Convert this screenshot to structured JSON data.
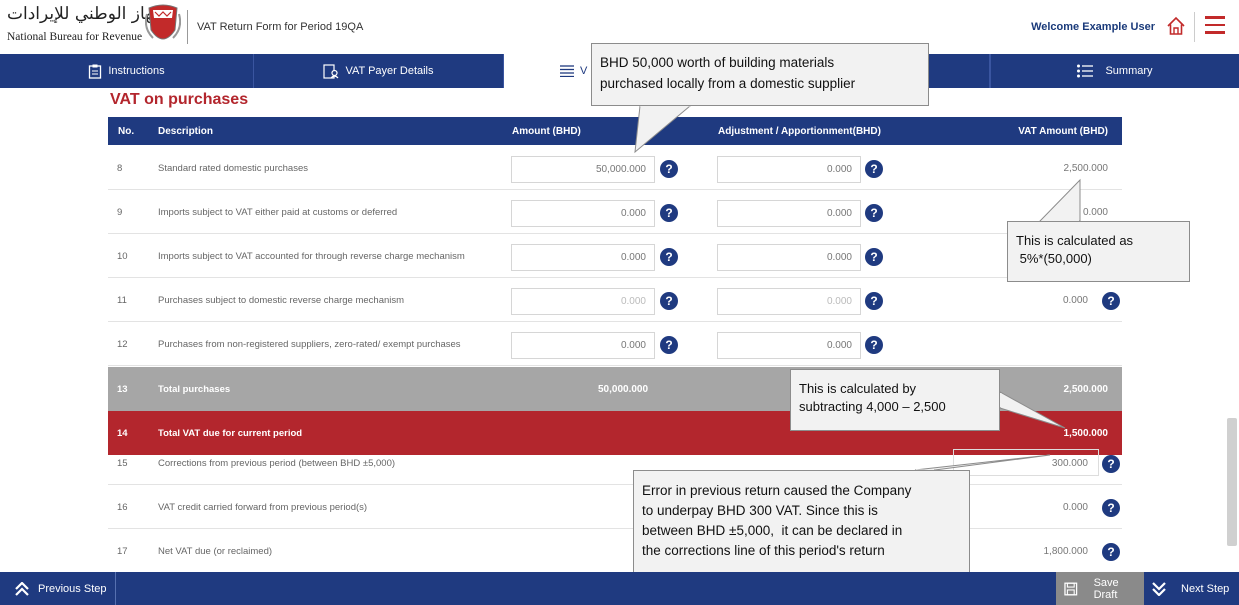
{
  "header": {
    "logo_arabic": "الجهاز الوطني للإيرادات",
    "logo_english": "National Bureau for Revenue",
    "form_title": "VAT Return Form for Period 19QA",
    "welcome": "Welcome Example User"
  },
  "tabs": [
    {
      "label": "Instructions",
      "icon": "clipboard-icon"
    },
    {
      "label": "VAT Payer Details",
      "icon": "user-doc-icon"
    },
    {
      "label": "V",
      "icon": "list-icon"
    },
    {
      "label": "",
      "icon": ""
    },
    {
      "label": "Summary",
      "icon": "summary-list-icon"
    }
  ],
  "section_title": "VAT on purchases",
  "table": {
    "headers": {
      "no": "No.",
      "description": "Description",
      "amount": "Amount (BHD)",
      "adjustment": "Adjustment / Apportionment(BHD)",
      "vat": "VAT Amount (BHD)"
    },
    "rows": [
      {
        "no": "8",
        "description": "Standard rated domestic purchases",
        "amount": "50,000.000",
        "adjustment": "0.000",
        "vat": "2,500.000"
      },
      {
        "no": "9",
        "description": "Imports subject to VAT either paid at customs or deferred",
        "amount": "0.000",
        "adjustment": "0.000",
        "vat": "0.000"
      },
      {
        "no": "10",
        "description": "Imports subject to VAT accounted for through reverse charge mechanism",
        "amount": "0.000",
        "adjustment": "0.000",
        "vat": ""
      },
      {
        "no": "11",
        "description": "Purchases subject to domestic reverse charge mechanism",
        "amount": "0.000",
        "adjustment": "0.000",
        "vat": "0.000"
      },
      {
        "no": "12",
        "description": "Purchases from non-registered suppliers, zero-rated/ exempt purchases",
        "amount": "0.000",
        "adjustment": "0.000",
        "vat": ""
      }
    ],
    "total": {
      "no": "13",
      "description": "Total purchases",
      "amount": "50,000.000",
      "vat": "2,500.000"
    },
    "due": {
      "no": "14",
      "description": "Total VAT due for current period",
      "vat": "1,500.000"
    },
    "lower_rows": [
      {
        "no": "15",
        "description": "Corrections from previous period (between BHD ±5,000)",
        "vat": "300.000"
      },
      {
        "no": "16",
        "description": "VAT credit carried forward from previous period(s)",
        "vat": "0.000"
      },
      {
        "no": "17",
        "description": "Net VAT due (or reclaimed)",
        "vat": "1,800.000"
      }
    ],
    "help_symbol": "?"
  },
  "callouts": {
    "building_materials": [
      "BHD 50,000  worth of building materials",
      "purchased locally from a domestic supplier"
    ],
    "calc_5pct": [
      "This is calculated as",
      " 5%*(50,000)"
    ],
    "calc_subtract": [
      "This is calculated by",
      "subtracting 4,000 – 2,500"
    ],
    "error_note": [
      "Error in previous return caused the Company",
      "to underpay BHD 300 VAT. Since this is",
      "between BHD ±5,000,  it can be declared in",
      "the corrections line of this period's return"
    ]
  },
  "footer": {
    "previous": "Previous Step",
    "save": "Save Draft",
    "next": "Next Step"
  },
  "colors": {
    "navy": "#1f3a80",
    "red": "#b3262d",
    "gray_total": "#a6a6a6"
  }
}
